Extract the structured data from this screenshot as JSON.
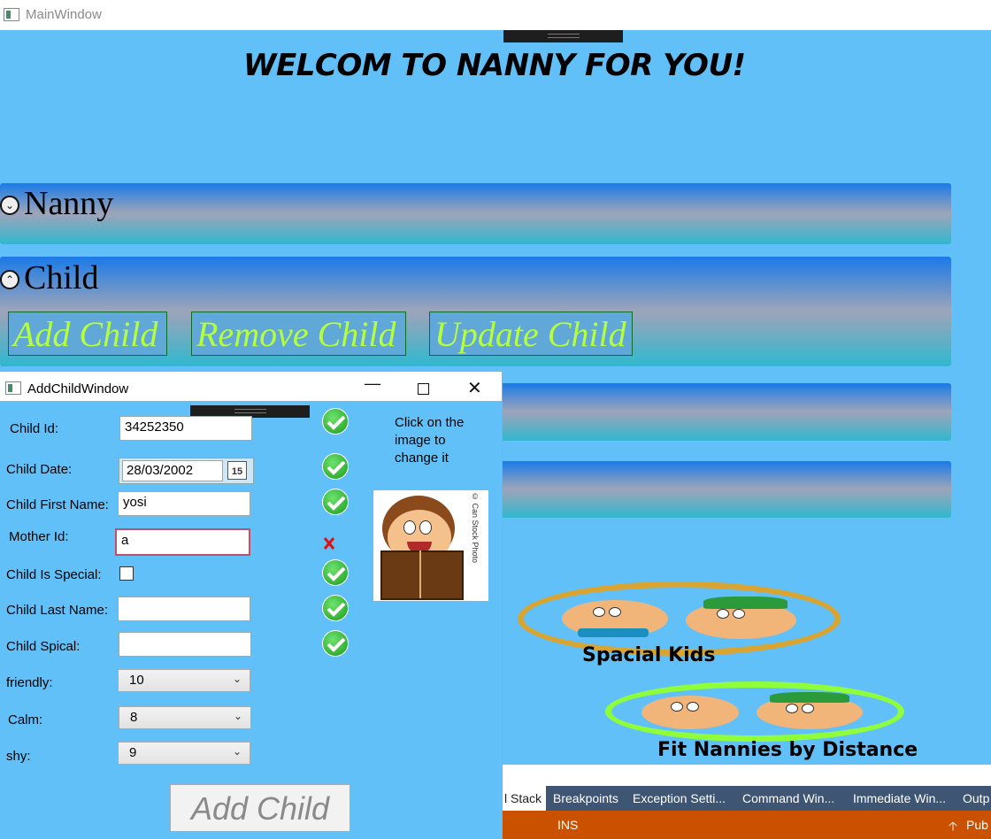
{
  "main_window": {
    "title": "MainWindow"
  },
  "welcome_text": "WELCOM TO NANNY FOR YOU!",
  "expanders": {
    "nanny": "Nanny",
    "child": "Child"
  },
  "child_buttons": {
    "add": "Add Child",
    "remove": "Remove Child",
    "update": "Update Child"
  },
  "ring_labels": {
    "special": "Spacial Kids",
    "distance": "Fit Nannies by Distance"
  },
  "colors": {
    "background": "#62c0f8",
    "button_text": "#b6ff3c",
    "vs_tabs": "#3f5574",
    "vs_status": "#ca5100"
  },
  "child_window": {
    "title": "AddChildWindow",
    "labels": {
      "child_id": "Child Id:",
      "child_date": "Child Date:",
      "first_name": "Child First Name:",
      "mother_id": "Mother Id:",
      "is_special": "Child Is Special:",
      "last_name": "Child Last Name:",
      "spical": "Child Spical:",
      "friendly": "friendly:",
      "calm": "Calm:",
      "shy": "shy:"
    },
    "values": {
      "child_id": "34252350",
      "child_date": "28/03/2002",
      "calendar_day": "15",
      "first_name": "yosi",
      "mother_id": "a",
      "last_name": "",
      "spical": "",
      "friendly": "10",
      "calm": "8",
      "shy": "9",
      "is_special_checked": false
    },
    "image_hint": "Click on the image to change it",
    "image_watermark": "© Can Stock Photo",
    "add_button": "Add Child"
  },
  "vs_tabs": [
    "l Stack",
    "Breakpoints",
    "Exception Setti...",
    "Command Win...",
    "Immediate Win...",
    "Outp"
  ],
  "vs_status": {
    "mode": "INS",
    "publish": "Pub"
  }
}
